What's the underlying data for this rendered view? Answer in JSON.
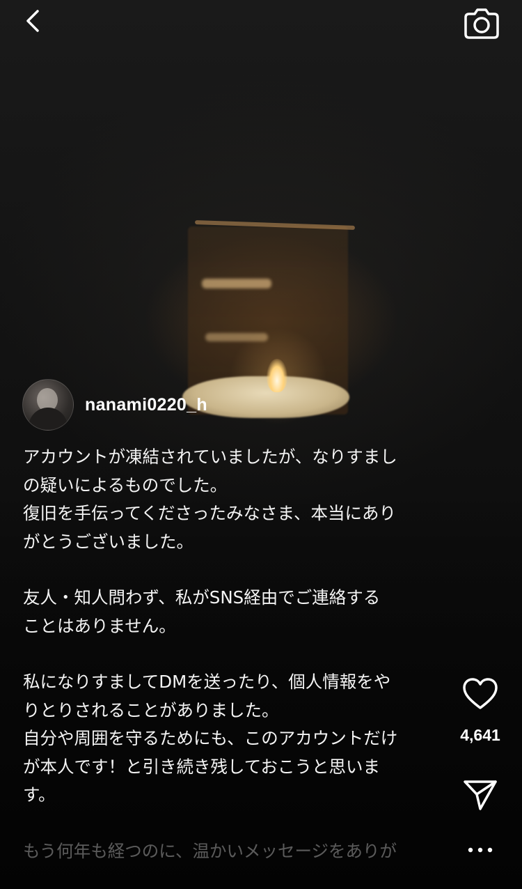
{
  "post": {
    "username": "nanami0220_h",
    "caption": {
      "p1_line1": "アカウントが凍結されていましたが、なりすまし",
      "p1_line2": "の疑いによるものでした。",
      "p2_line1": "復旧を手伝ってくださったみなさま、本当にあり",
      "p2_line2": "がとうございました。",
      "p3_line1": "友人・知人問わず、私がSNS経由でご連絡する",
      "p3_line2": "ことはありません。",
      "p4_line1": "私になりすましてDMを送ったり、個人情報をや",
      "p4_line2": "りとりされることがありました。",
      "p5_line1": "自分や周囲を守るためにも、このアカウントだけ",
      "p5_line2": "が本人です！と引き続き残しておこうと思いま",
      "p5_line3": "す。",
      "p6_line1": "もう何年も経つのに、温かいメッセージをありが"
    },
    "like_count": "4,641"
  },
  "icons": {
    "back": "chevron-left-icon",
    "camera": "camera-icon",
    "like": "heart-outline-icon",
    "share": "paper-plane-icon",
    "more": "ellipsis-icon"
  },
  "colors": {
    "text": "#ffffff",
    "background": "#0b0b0b"
  }
}
